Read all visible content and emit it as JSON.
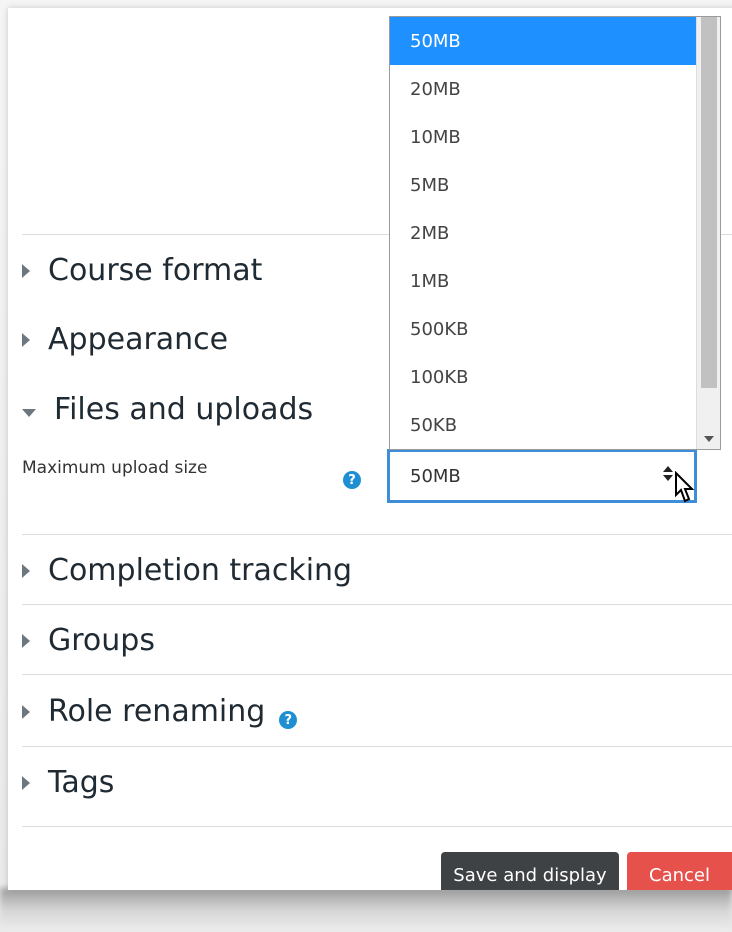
{
  "sections": {
    "course_format": "Course format",
    "appearance": "Appearance",
    "files_and_uploads": "Files and uploads",
    "completion_tracking": "Completion tracking",
    "groups": "Groups",
    "role_renaming": "Role renaming",
    "tags": "Tags"
  },
  "upload_field": {
    "label": "Maximum upload size",
    "selected_value": "50MB",
    "help_icon": "question-circle-icon"
  },
  "dropdown": {
    "options": [
      "50MB",
      "20MB",
      "10MB",
      "5MB",
      "2MB",
      "1MB",
      "500KB",
      "100KB",
      "50KB"
    ],
    "selected_index": 0,
    "selected_color": "#1e90ff"
  },
  "buttons": {
    "save_label": "Save and display",
    "cancel_label": "Cancel"
  },
  "colors": {
    "help_icon": "#1f8fd3",
    "focus_border": "#3d8ed7",
    "save_button": "#3f4244",
    "cancel_button": "#e6514c"
  }
}
